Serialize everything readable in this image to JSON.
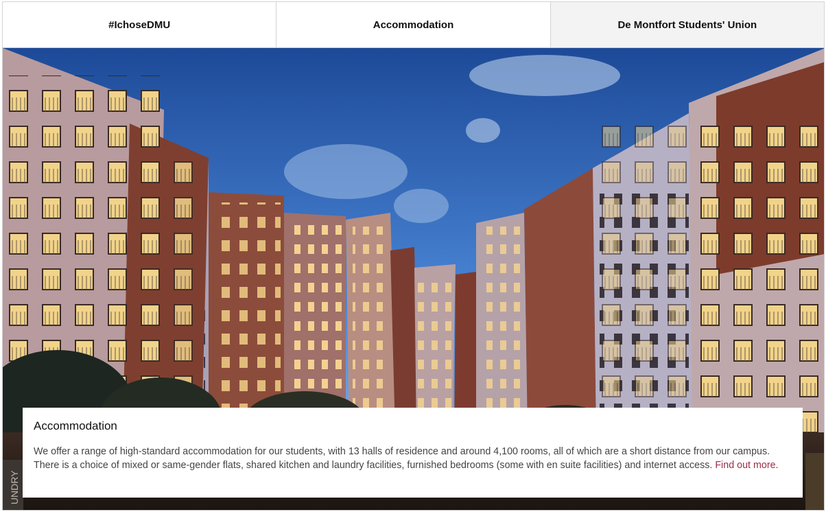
{
  "tabs": [
    {
      "label": "#IchoseDMU",
      "active": false
    },
    {
      "label": "Accommodation",
      "active": false
    },
    {
      "label": "De Montfort Students' Union",
      "active": true
    }
  ],
  "hero": {
    "image": "student-halls-photo",
    "sign_text": "UNDRY"
  },
  "caption": {
    "title": "Accommodation",
    "body": "We offer a range of high-standard accommodation for our students, with 13 halls of residence and around 4,100 rooms, all of which are a short distance from our campus. There is a choice of mixed or same-gender flats, shared kitchen and laundry facilities, furnished bedrooms (some with en suite facilities) and internet access. ",
    "link_text": "Find out more",
    "trailing": "."
  },
  "colors": {
    "link": "#9b2d47",
    "sky_top": "#1f4f9e",
    "sky_bottom": "#7fb3ee",
    "brick": "#8a4a3c",
    "window_lit": "#f3d58a"
  }
}
